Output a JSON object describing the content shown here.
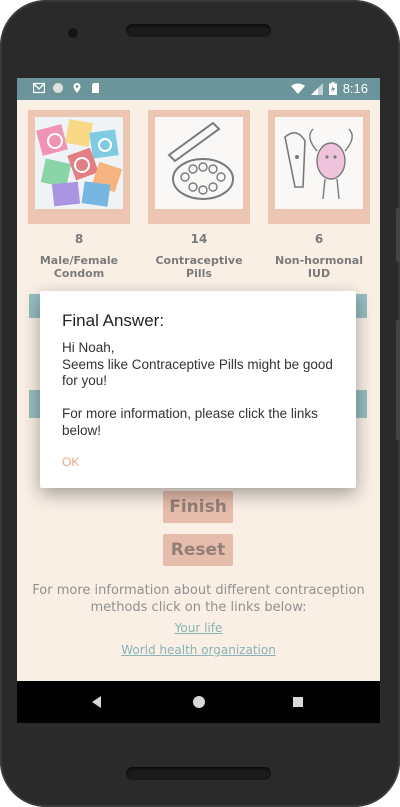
{
  "status_bar": {
    "time": "8:16",
    "icons_left": [
      "gmail-icon",
      "circle-icon",
      "location-icon",
      "sd-card-icon"
    ],
    "icons_right": [
      "wifi-icon",
      "signal-icon",
      "battery-icon"
    ]
  },
  "methods": [
    {
      "count": "8",
      "name": "Male/Female Condom"
    },
    {
      "count": "14",
      "name": "Contraceptive Pills"
    },
    {
      "count": "6",
      "name": "Non-hormonal IUD"
    }
  ],
  "buttons": {
    "finish": "Finish",
    "reset": "Reset"
  },
  "info": {
    "text": "For more information about different contraception methods click on the links below:",
    "link1": "Your life",
    "link2": "World health organization"
  },
  "dialog": {
    "title": "Final Answer:",
    "message": "Hi Noah,\nSeems like Contraceptive Pills might be good for you!\n\nFor more information, please click the links below!",
    "ok": "OK"
  },
  "colors": {
    "status_bar": "#1c5d64",
    "accent": "#e4a88a",
    "teal": "#5e9aa0"
  }
}
